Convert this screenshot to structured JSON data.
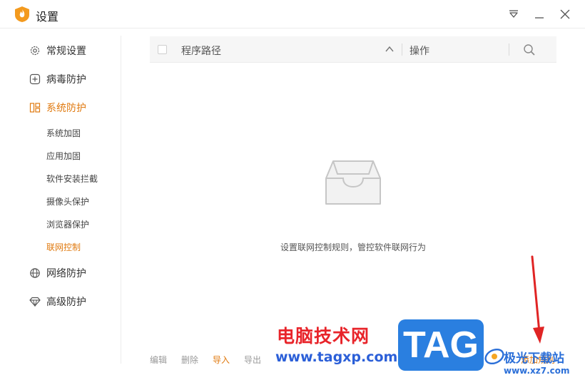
{
  "window": {
    "title": "设置"
  },
  "sidebar": {
    "items": [
      {
        "label": "常规设置",
        "icon": "gear-icon"
      },
      {
        "label": "病毒防护",
        "icon": "plus-box-icon"
      },
      {
        "label": "系统防护",
        "icon": "system-protect-icon",
        "active": true
      },
      {
        "label": "网络防护",
        "icon": "globe-icon"
      },
      {
        "label": "高级防护",
        "icon": "diamond-icon"
      }
    ],
    "subitems": [
      {
        "label": "系统加固"
      },
      {
        "label": "应用加固"
      },
      {
        "label": "软件安装拦截"
      },
      {
        "label": "摄像头保护"
      },
      {
        "label": "浏览器保护"
      },
      {
        "label": "联网控制",
        "active": true
      }
    ]
  },
  "table": {
    "col_path": "程序路径",
    "col_action": "操作"
  },
  "empty": {
    "message": "设置联网控制规则，管控软件联网行为"
  },
  "bottom": {
    "edit": "编辑",
    "delete": "删除",
    "import": "导入",
    "export": "导出",
    "add_rule": "添加规则"
  },
  "watermark": {
    "cn_text": "电脑技术网",
    "url": "www.tagxp.com",
    "tag": "TAG",
    "site_name": "极光下载站",
    "site_url": "www.xz7.com"
  },
  "colors": {
    "accent": "#e07a10",
    "text": "#333333",
    "muted": "#999999",
    "header_bg": "#f6f6f6",
    "divider": "#ececec"
  }
}
